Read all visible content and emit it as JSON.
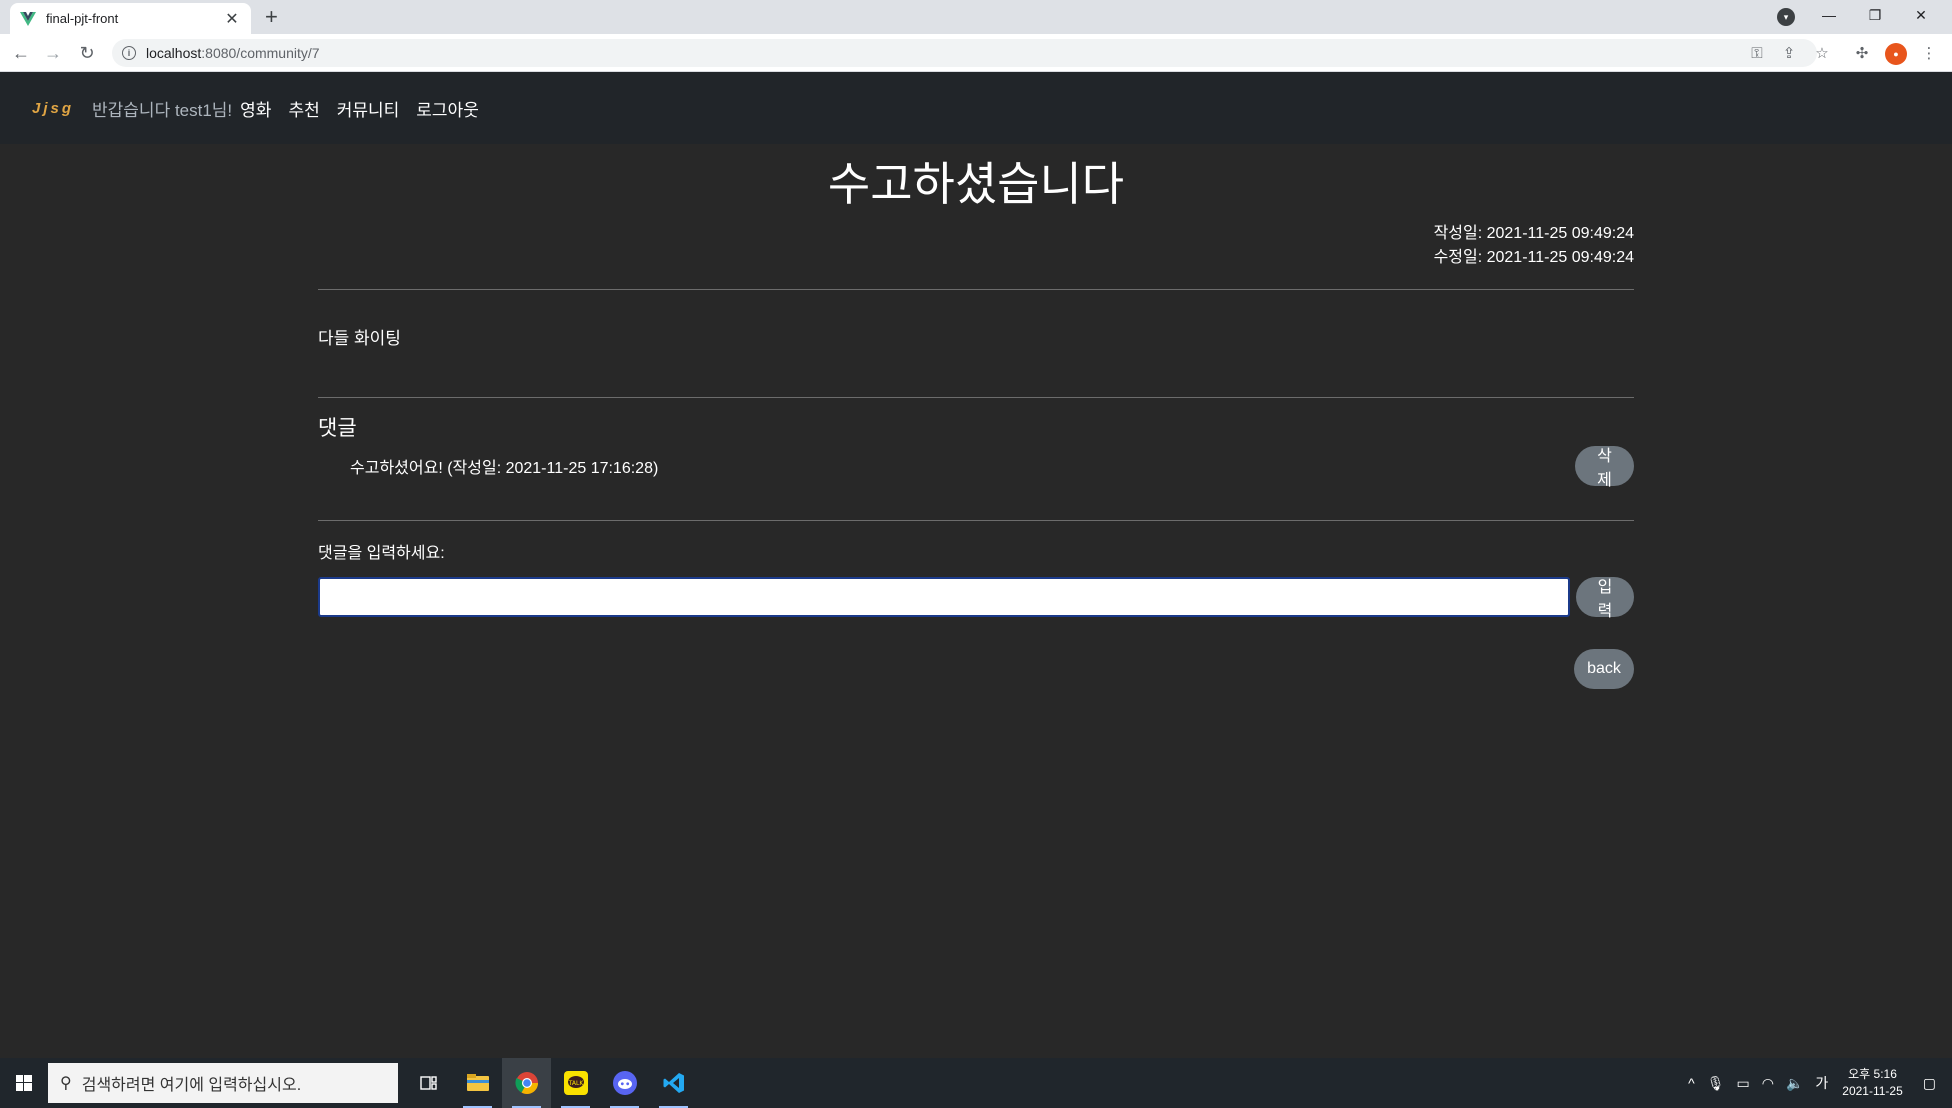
{
  "browser": {
    "tab_title": "final-pjt-front",
    "new_tab": "+",
    "url_host": "localhost",
    "url_path": ":8080/community/7"
  },
  "navbar": {
    "brand": "Jjsg",
    "greeting": "반갑습니다 test1님!",
    "links": [
      "영화",
      "추천",
      "커뮤니티",
      "로그아웃"
    ]
  },
  "post": {
    "title": "수고하셨습니다",
    "created": "작성일: 2021-11-25 09:49:24",
    "updated": "수정일: 2021-11-25 09:49:24",
    "content": "다들 화이팅"
  },
  "comments": {
    "title": "댓글",
    "items": [
      {
        "text": "수고하셨어요! (작성일: 2021-11-25 17:16:28)",
        "delete_label": "삭제"
      }
    ],
    "input_label": "댓글을 입력하세요:",
    "input_value": "",
    "submit_label": "입력",
    "back_label": "back"
  },
  "taskbar": {
    "search_placeholder": "검색하려면 여기에 입력하십시오.",
    "ime": "가",
    "time": "오후 5:16",
    "date": "2021-11-25"
  },
  "colors": {
    "page_bg": "#282828",
    "navbar_bg": "#212529",
    "brand": "#e0a544",
    "pill_button": "#6c757d"
  }
}
